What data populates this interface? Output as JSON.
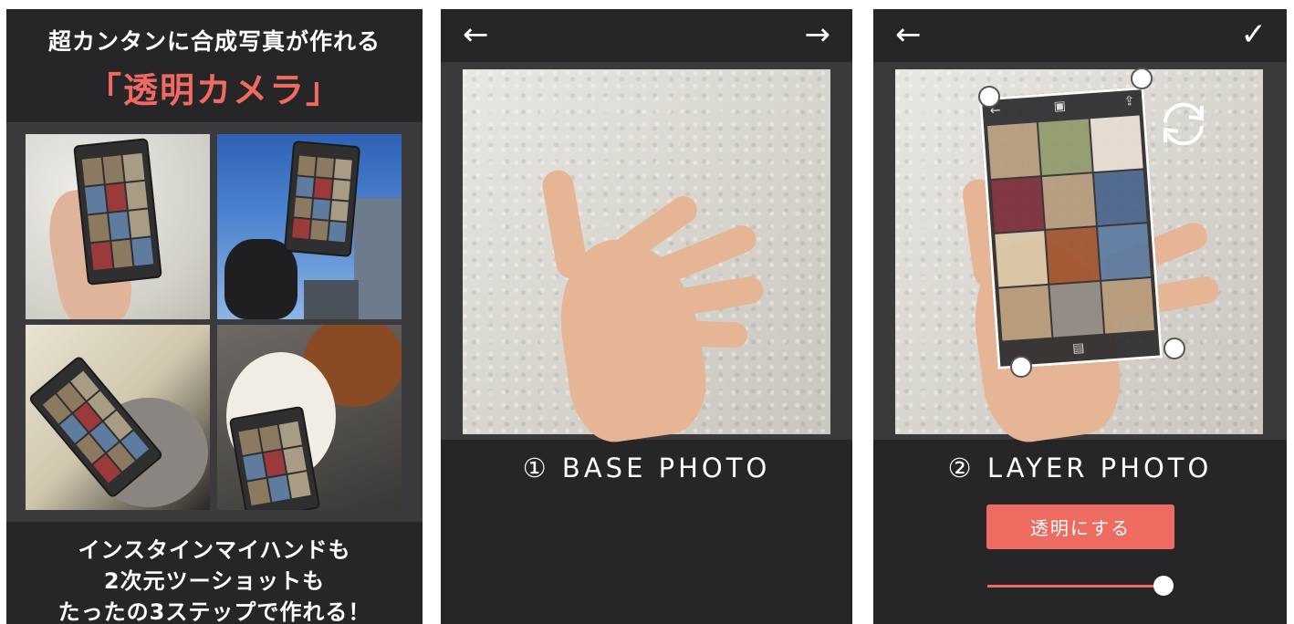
{
  "promo": {
    "title": "超カンタンに合成写真が作れる",
    "app_name": "「透明カメラ」",
    "footer": [
      "インスタインマイハンドも",
      "2次元ツーショットも",
      "たったの3ステップで作れる！"
    ]
  },
  "base_step": {
    "back_icon": "←",
    "forward_icon": "→",
    "caption": "① BASE PHOTO"
  },
  "layer_step": {
    "back_icon": "←",
    "done_icon": "✓",
    "caption": "② LAYER PHOTO",
    "layer_toolbar": {
      "back": "←",
      "save": "▣",
      "share": "⇪",
      "mid": "▤"
    },
    "transparent_button": "透明にする",
    "opacity": 1.0
  },
  "colors": {
    "accent": "#ee6b62",
    "background": "#262628"
  }
}
